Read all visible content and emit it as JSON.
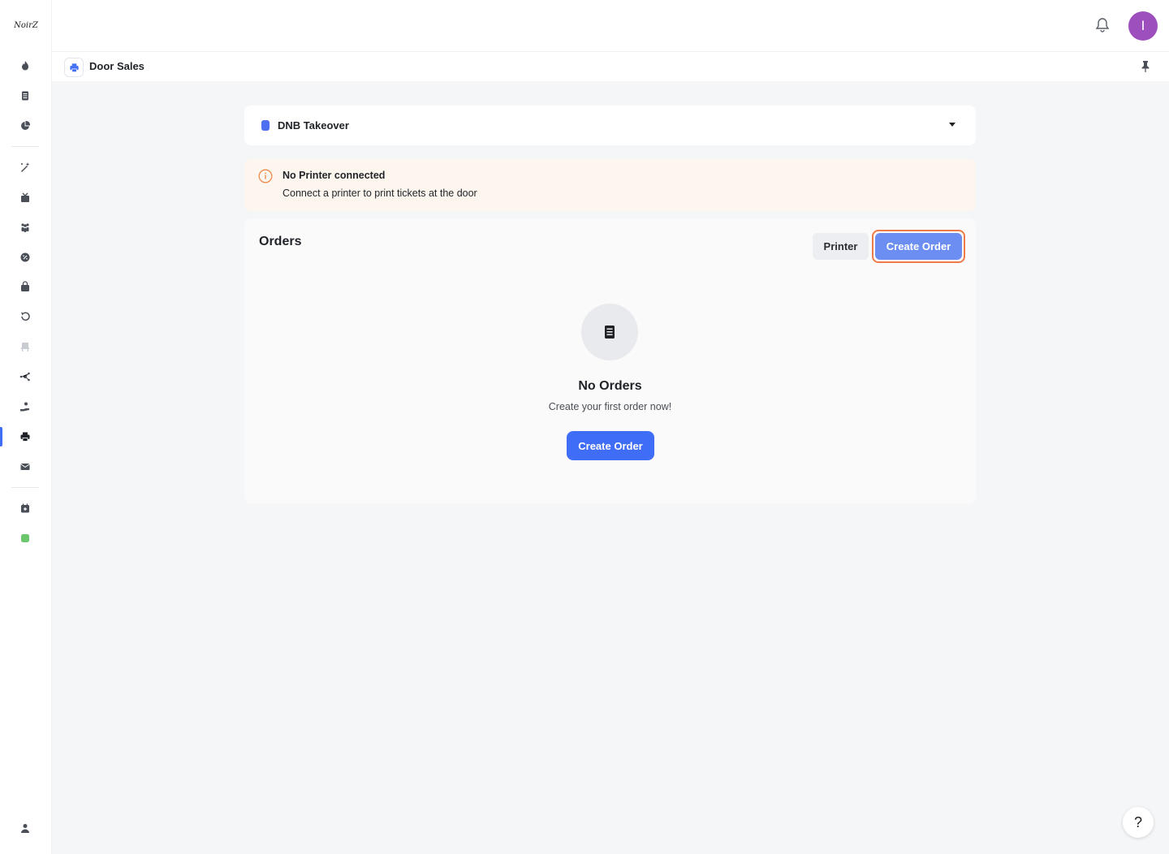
{
  "sidebar": {
    "logo_text": "NoirZ",
    "items": [
      {
        "icon": "flame-icon"
      },
      {
        "icon": "document-icon"
      },
      {
        "icon": "pie-chart-icon"
      },
      {
        "icon": "magic-wand-icon"
      },
      {
        "icon": "gift-icon"
      },
      {
        "icon": "users-icon"
      },
      {
        "icon": "percent-badge-icon"
      },
      {
        "icon": "bag-icon"
      },
      {
        "icon": "refund-icon"
      },
      {
        "icon": "seat-icon"
      },
      {
        "icon": "network-icon"
      },
      {
        "icon": "hand-money-icon"
      },
      {
        "icon": "printer-icon",
        "active": true
      },
      {
        "icon": "mail-icon"
      },
      {
        "icon": "calendar-add-icon"
      },
      {
        "icon": "status-green-icon"
      },
      {
        "icon": "user-icon"
      }
    ]
  },
  "topbar": {
    "avatar_initial": "I",
    "avatar_color": "#9c4fbd"
  },
  "subheader": {
    "title": "Door Sales",
    "icon": "printer-icon"
  },
  "event_select": {
    "selected": "DNB Takeover",
    "color": "#4d6ff0"
  },
  "alert": {
    "title": "No Printer connected",
    "message": "Connect a printer to print tickets at the door"
  },
  "orders": {
    "title": "Orders",
    "printer_button": "Printer",
    "create_button": "Create Order",
    "empty_title": "No Orders",
    "empty_subtitle": "Create your first order now!",
    "empty_create_button": "Create Order"
  },
  "help": {
    "label": "?"
  },
  "colors": {
    "accent": "#3f6df5",
    "highlight": "#ee7b4b",
    "alert_bg": "#fdf6ef"
  }
}
